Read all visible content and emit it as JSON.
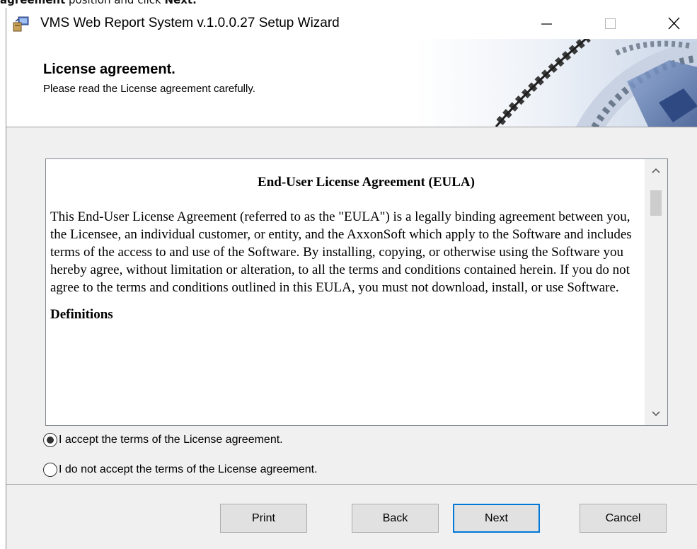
{
  "caption": {
    "strong_word": "agreement",
    "middle_text": " position and click ",
    "strong_end": "Next."
  },
  "window": {
    "title": "VMS Web Report System v.1.0.0.27 Setup Wizard",
    "controls": {
      "minimize": "minimize-icon",
      "maximize": "maximize-icon",
      "close": "close-icon"
    }
  },
  "header": {
    "title": "License agreement.",
    "subtitle": "Please read the License agreement carefully."
  },
  "eula": {
    "title": "End-User License Agreement (EULA)",
    "body": "This End-User License Agreement (referred to as the \"EULA\") is a legally binding agreement between you, the Licensee, an individual customer, or entity, and the AxxonSoft which apply to the Software and includes terms of the access to and use of the Software. By installing, copying, or otherwise using the Software you hereby agree, without limitation or alteration, to all the terms and conditions contained herein. If you do not agree to the terms and conditions outlined in this EULA, you must not download, install, or use Software.",
    "next_heading": "Definitions"
  },
  "options": {
    "accept": {
      "label": "I accept the terms of the License agreement.",
      "checked": true
    },
    "decline": {
      "label": "I do not accept the terms of the License agreement.",
      "checked": false
    }
  },
  "buttons": {
    "print": "Print",
    "back": "Back",
    "next": "Next",
    "cancel": "Cancel"
  },
  "colors": {
    "default_button_border": "#0078d7",
    "dialog_background": "#f0f0f0"
  }
}
